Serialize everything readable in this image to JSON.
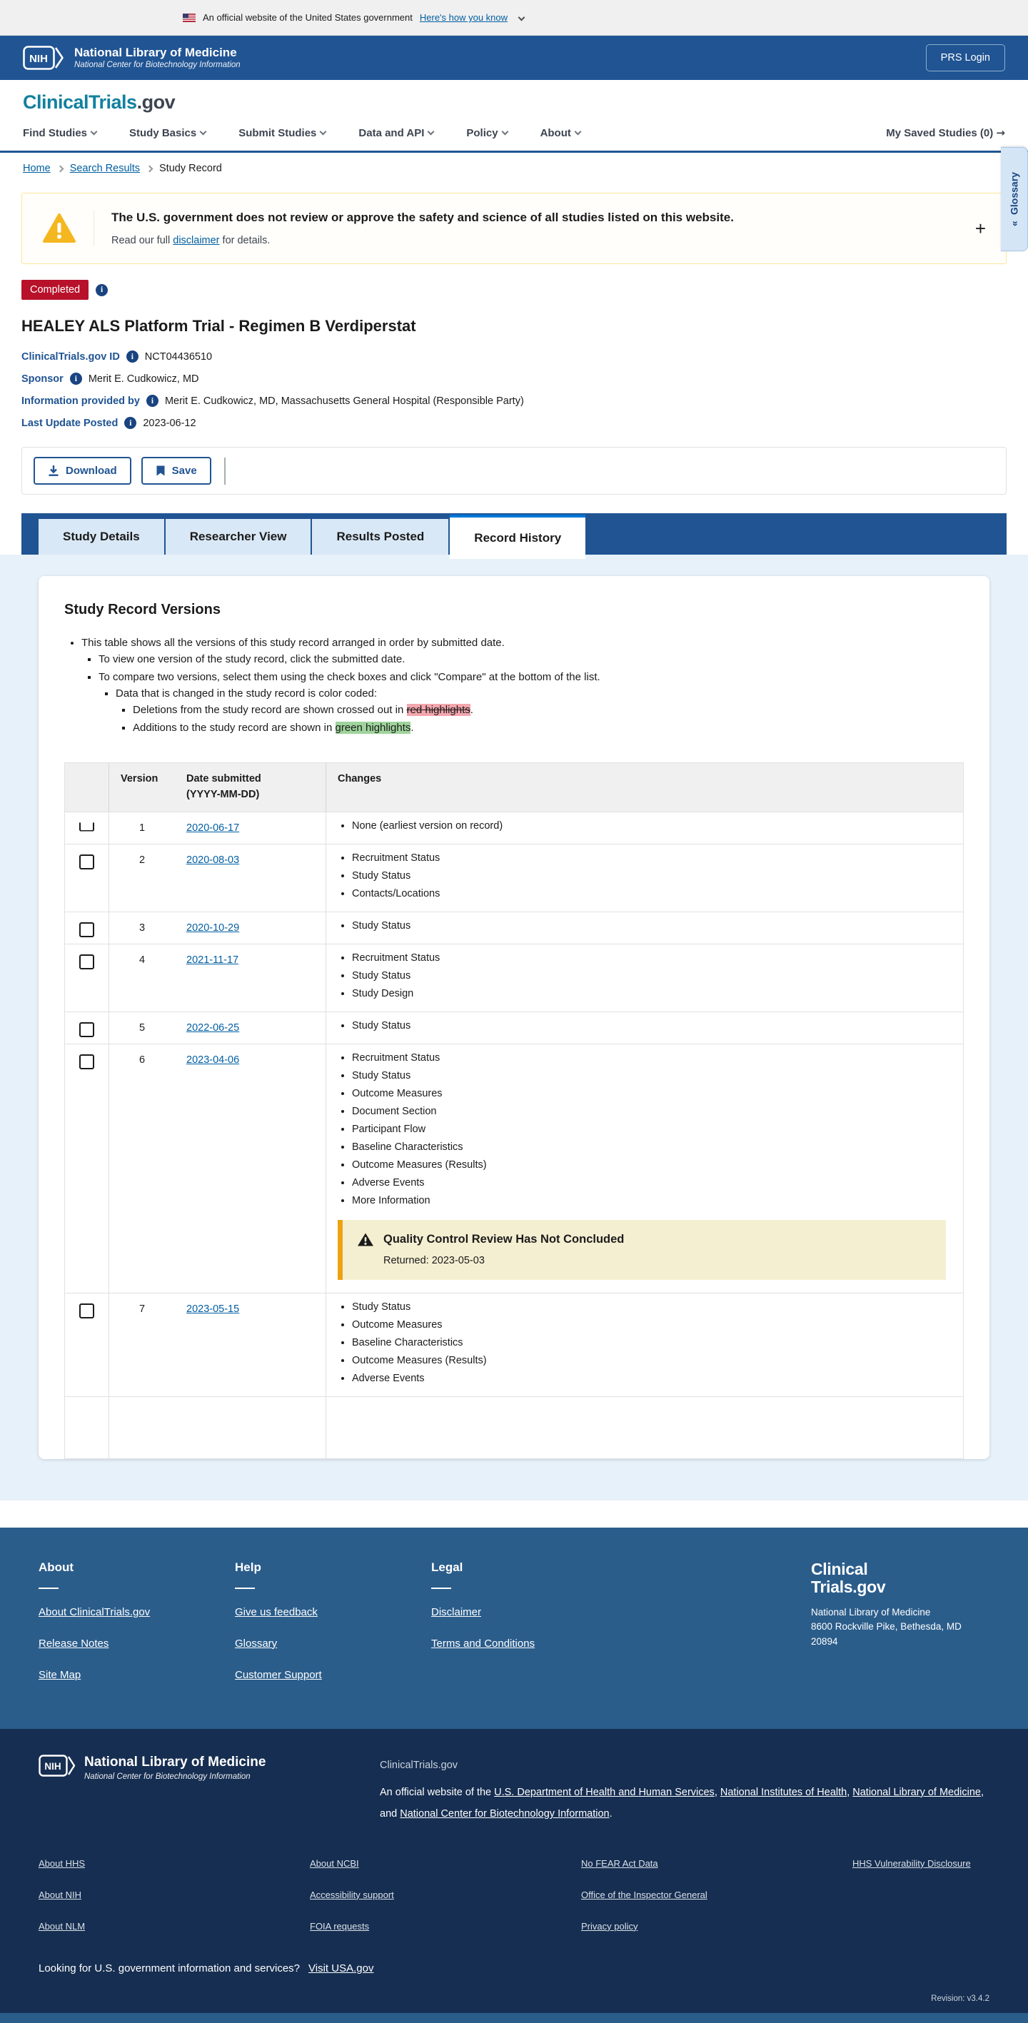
{
  "icons": {
    "expand": "+",
    "arrow_right": "→",
    "glossary_chevrons": "«",
    "info": "i"
  },
  "gov_banner": {
    "text": "An official website of the United States government",
    "link": "Here's how you know"
  },
  "nlm_header": {
    "org": "National Library of Medicine",
    "sub": "National Center for Biotechnology Information",
    "prs_login": "PRS Login"
  },
  "site_header": {
    "logo_primary": "ClinicalTrials",
    "logo_suffix": ".gov",
    "nav": [
      {
        "label": "Find Studies"
      },
      {
        "label": "Study Basics"
      },
      {
        "label": "Submit Studies"
      },
      {
        "label": "Data and API"
      },
      {
        "label": "Policy"
      },
      {
        "label": "About"
      }
    ],
    "saved_label": "My Saved Studies (0)"
  },
  "breadcrumb": [
    {
      "label": "Home",
      "link": true
    },
    {
      "label": "Search Results",
      "link": true
    },
    {
      "label": "Study Record",
      "link": false
    }
  ],
  "glossary_label": "Glossary",
  "disclaimer": {
    "title": "The U.S. government does not review or approve the safety and science of all studies listed on this website.",
    "pre": "Read our full ",
    "link": "disclaimer",
    "post": " for details."
  },
  "study": {
    "status": "Completed",
    "title": "HEALEY ALS Platform Trial - Regimen B Verdiperstat",
    "fields": [
      {
        "label": "ClinicalTrials.gov ID",
        "value": "NCT04436510"
      },
      {
        "label": "Sponsor",
        "value": "Merit E. Cudkowicz, MD"
      },
      {
        "label": "Information provided by",
        "value": "Merit E. Cudkowicz, MD, Massachusetts General Hospital (Responsible Party)"
      },
      {
        "label": "Last Update Posted",
        "value": "2023-06-12"
      }
    ]
  },
  "actions": {
    "download": "Download",
    "save": "Save"
  },
  "tabs": [
    {
      "label": "Study Details",
      "active": false
    },
    {
      "label": "Researcher View",
      "active": false
    },
    {
      "label": "Results Posted",
      "active": false
    },
    {
      "label": "Record History",
      "active": true
    }
  ],
  "record_versions": {
    "heading": "Study Record Versions",
    "intro": {
      "l1": "This table shows all the versions of this study record arranged in order by submitted date.",
      "l2a": "To view one version of the study record, click the submitted date.",
      "l2b": "To compare two versions, select them using the check boxes and click \"Compare\" at the bottom of the list.",
      "l3": "Data that is changed in the study record is color coded:",
      "l4a_pre": "Deletions from the study record are shown crossed out in ",
      "l4a_hl": "red highlights",
      "l4a_post": ".",
      "l4b_pre": "Additions to the study record are shown in ",
      "l4b_hl": "green highlights",
      "l4b_post": "."
    },
    "table": {
      "headers": {
        "version": "Version",
        "date_line1": "Date submitted",
        "date_line2": "(YYYY-MM-DD)",
        "changes": "Changes"
      },
      "rows": [
        {
          "version": "1",
          "date": "2020-06-17",
          "changes": [
            "None (earliest version on record)"
          ],
          "clipped": true
        },
        {
          "version": "2",
          "date": "2020-08-03",
          "changes": [
            "Recruitment Status",
            "Study Status",
            "Contacts/Locations"
          ]
        },
        {
          "version": "3",
          "date": "2020-10-29",
          "changes": [
            "Study Status"
          ]
        },
        {
          "version": "4",
          "date": "2021-11-17",
          "changes": [
            "Recruitment Status",
            "Study Status",
            "Study Design"
          ]
        },
        {
          "version": "5",
          "date": "2022-06-25",
          "changes": [
            "Study Status"
          ]
        },
        {
          "version": "6",
          "date": "2023-04-06",
          "changes": [
            "Recruitment Status",
            "Study Status",
            "Outcome Measures",
            "Document Section",
            "Participant Flow",
            "Baseline Characteristics",
            "Outcome Measures (Results)",
            "Adverse Events",
            "More Information"
          ],
          "notice": true
        },
        {
          "version": "7",
          "date": "2023-05-15",
          "changes": [
            "Study Status",
            "Outcome Measures",
            "Baseline Characteristics",
            "Outcome Measures (Results)",
            "Adverse Events"
          ]
        }
      ]
    },
    "qc_notice": {
      "title": "Quality Control Review Has Not Concluded",
      "returned": "Returned: 2023-05-03"
    }
  },
  "footer_mid": {
    "columns": [
      {
        "heading": "About",
        "links": [
          "About ClinicalTrials.gov",
          "Release Notes",
          "Site Map"
        ]
      },
      {
        "heading": "Help",
        "links": [
          "Give us feedback",
          "Glossary",
          "Customer Support"
        ]
      },
      {
        "heading": "Legal",
        "links": [
          "Disclaimer",
          "Terms and Conditions"
        ]
      }
    ],
    "brand_line1": "Clinical",
    "brand_line2": "Trials.gov",
    "address": "National Library of Medicine\n8600 Rockville Pike, Bethesda, MD 20894"
  },
  "footer_dark": {
    "org": "National Library of Medicine",
    "sub": "National Center for Biotechnology Information",
    "site": "ClinicalTrials.gov",
    "statement_parts": [
      {
        "t": "An official website of the "
      },
      {
        "t": "U.S. Department of Health and Human Services",
        "link": true
      },
      {
        "t": ", "
      },
      {
        "t": "National Institutes of Health",
        "link": true
      },
      {
        "t": ", "
      },
      {
        "t": "National Library of Medicine",
        "link": true
      },
      {
        "t": ", and "
      },
      {
        "t": "National Center for Biotechnology Information",
        "link": true
      },
      {
        "t": "."
      }
    ],
    "link_columns": [
      [
        "About HHS",
        "About NIH",
        "About NLM"
      ],
      [
        "About NCBI",
        "Accessibility support",
        "FOIA requests"
      ],
      [
        "No FEAR Act Data",
        "Office of the Inspector General",
        "Privacy policy"
      ],
      [
        "HHS Vulnerability Disclosure"
      ]
    ],
    "usa_prompt": "Looking for U.S. government information and services?",
    "usa_link": "Visit USA.gov",
    "revision": "Revision: v3.4.2"
  }
}
